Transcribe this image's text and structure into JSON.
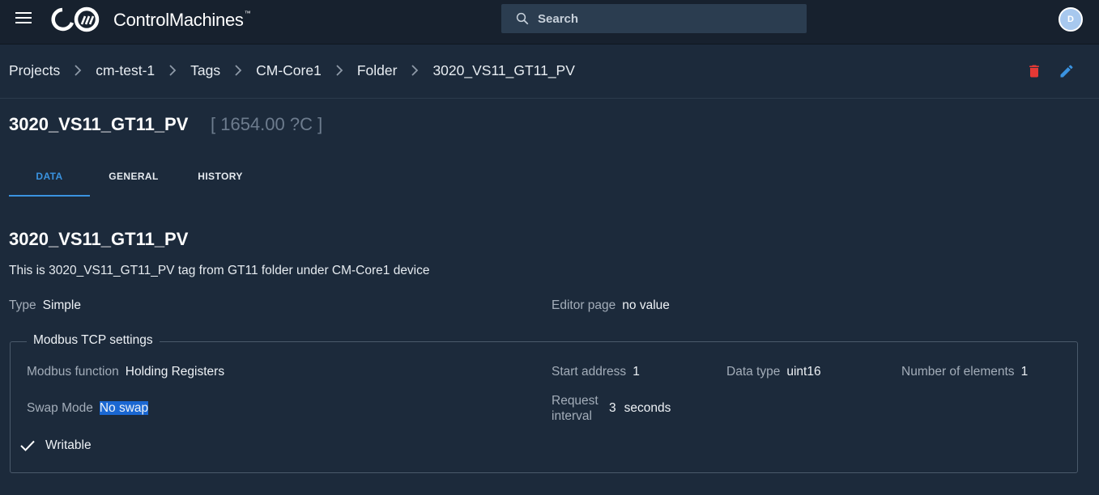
{
  "app": {
    "brand": "ControlMachines",
    "brand_mark": "™",
    "avatar_initial": "D"
  },
  "search": {
    "placeholder": "Search"
  },
  "breadcrumb": [
    "Projects",
    "cm-test-1",
    "Tags",
    "CM-Core1",
    "Folder",
    "3020_VS11_GT11_PV"
  ],
  "header": {
    "title": "3020_VS11_GT11_PV",
    "live_value": "[ 1654.00 ?C ]"
  },
  "tabs": [
    "DATA",
    "GENERAL",
    "HISTORY"
  ],
  "active_tab": "DATA",
  "data": {
    "name": "3020_VS11_GT11_PV",
    "description": "This is 3020_VS11_GT11_PV tag from GT11 folder under CM-Core1 device",
    "type_label": "Type",
    "type_value": "Simple",
    "editor_label": "Editor page",
    "editor_value": "no value"
  },
  "modbus": {
    "legend": "Modbus TCP settings",
    "function_label": "Modbus function",
    "function_value": "Holding Registers",
    "start_label": "Start address",
    "start_value": "1",
    "datatype_label": "Data type",
    "datatype_value": "uint16",
    "elements_label": "Number of elements",
    "elements_value": "1",
    "swap_label": "Swap Mode",
    "swap_value": "No swap",
    "interval_label_1": "Request",
    "interval_label_2": "interval",
    "interval_value": "3",
    "interval_unit": "seconds",
    "writable_label": "Writable",
    "writable_checked": true
  },
  "colors": {
    "accent": "#3a93e0",
    "delete": "#e53935",
    "background": "#1c2a3b",
    "topbar": "#17212e"
  },
  "icons": [
    "menu-icon",
    "search-icon",
    "chevron-right-icon",
    "delete-icon",
    "edit-icon",
    "check-icon"
  ]
}
